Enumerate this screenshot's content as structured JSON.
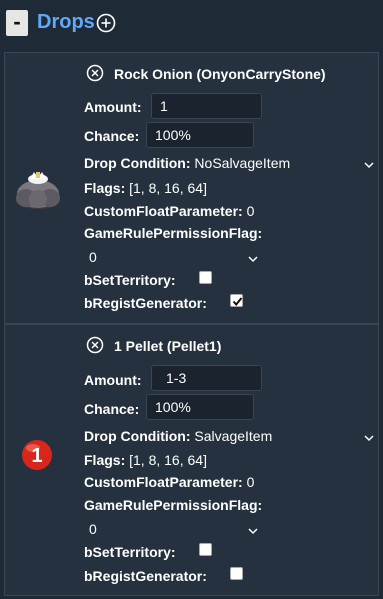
{
  "header": {
    "collapse_label": "-",
    "title": "Drops"
  },
  "drops": [
    {
      "title": "Rock Onion (OnyonCarryStone)",
      "amount_label": "Amount:",
      "amount": "1",
      "chance_label": "Chance:",
      "chance": "100%",
      "drop_condition_label": "Drop Condition:",
      "drop_condition": "NoSalvageItem",
      "flags_label": "Flags:",
      "flags": "[1, 8, 16, 64]",
      "custom_float_label": "CustomFloatParameter:",
      "custom_float": "0",
      "gamerule_label": "GameRulePermissionFlag:",
      "gamerule": "0",
      "set_territory_label": "bSetTerritory:",
      "set_territory_checked": false,
      "regist_generator_label": "bRegistGenerator:",
      "regist_generator_checked": true,
      "icon": "rock-onion-icon"
    },
    {
      "title": "1 Pellet (Pellet1)",
      "amount_label": "Amount:",
      "amount": "1-3",
      "chance_label": "Chance:",
      "chance": "100%",
      "drop_condition_label": "Drop Condition:",
      "drop_condition": "SalvageItem",
      "flags_label": "Flags:",
      "flags": "[1, 8, 16, 64]",
      "custom_float_label": "CustomFloatParameter:",
      "custom_float": "0",
      "gamerule_label": "GameRulePermissionFlag:",
      "gamerule": "0",
      "set_territory_label": "bSetTerritory:",
      "set_territory_checked": false,
      "regist_generator_label": "bRegistGenerator:",
      "regist_generator_checked": false,
      "icon": "red-pellet-icon",
      "icon_text": "1"
    }
  ],
  "colors": {
    "title_blue": "#61a9f5",
    "background": "#1f2a37",
    "card": "#25313e",
    "pellet_red": "#d9261c"
  }
}
